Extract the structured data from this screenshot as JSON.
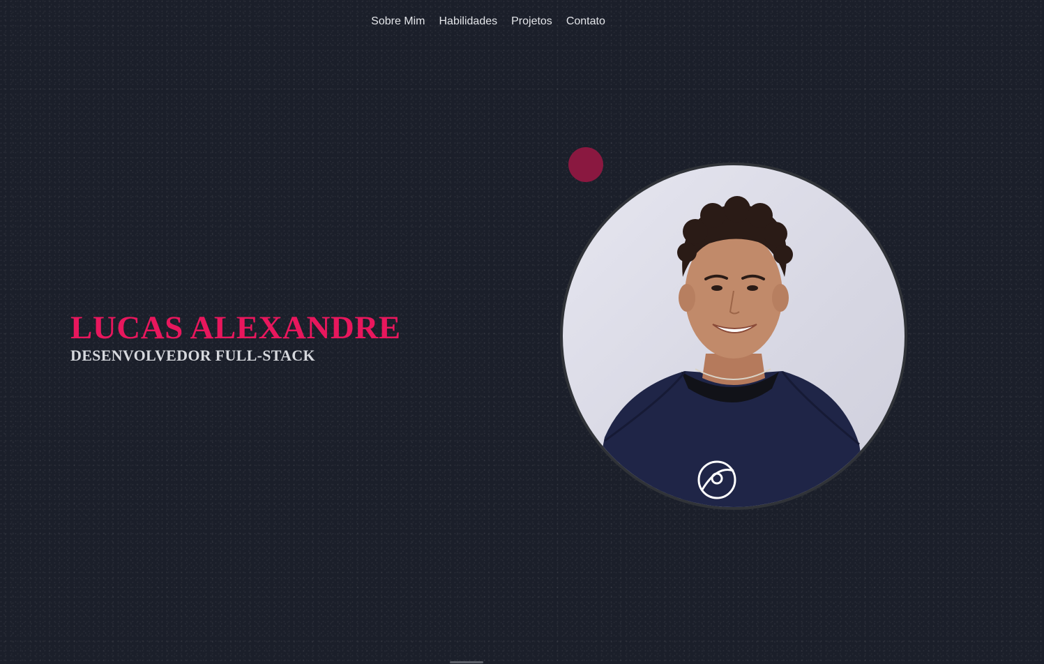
{
  "nav": {
    "items": [
      {
        "label": "Sobre Mim"
      },
      {
        "label": "Habilidades"
      },
      {
        "label": "Projetos"
      },
      {
        "label": "Contato"
      }
    ]
  },
  "hero": {
    "name": "LUCAS ALEXANDRE",
    "role": "DESENVOLVEDOR FULL-STACK",
    "photo_icon": "profile-photo"
  },
  "colors": {
    "background": "#1b1f2a",
    "accent": "#e8175d",
    "role_text": "#d6d8dd",
    "dot": "#8a1840",
    "nav_text": "#e4e6ea"
  }
}
